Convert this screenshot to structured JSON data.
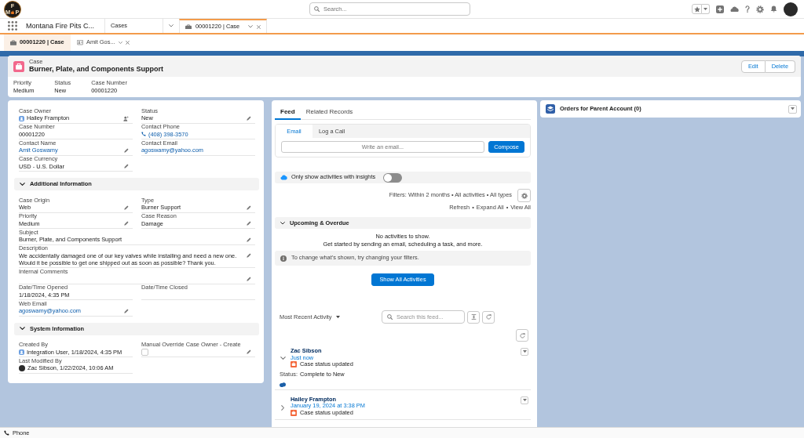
{
  "header": {
    "logo": {
      "letters": [
        "F",
        "M",
        "P"
      ]
    },
    "search": {
      "placeholder": "Search..."
    }
  },
  "nav": {
    "app_name": "Montana Fire Pits C...",
    "tabs": [
      {
        "kind": "object",
        "label": "Cases",
        "selected": false
      },
      {
        "kind": "record",
        "label": "00001220 | Case",
        "selected": true
      }
    ]
  },
  "subtabs": [
    {
      "kind": "case",
      "label": "00001220 | Case",
      "selected": true
    },
    {
      "kind": "contact",
      "label": "Amit Gos...",
      "selected": false
    }
  ],
  "record": {
    "object": "Case",
    "title": "Burner, Plate, and Components Support",
    "actions": [
      "Edit",
      "Delete"
    ],
    "highlights": [
      {
        "label": "Priority",
        "value": "Medium"
      },
      {
        "label": "Status",
        "value": "New"
      },
      {
        "label": "Case Number",
        "value": "00001220"
      }
    ]
  },
  "details": {
    "sections": [
      {
        "rows": [
          {
            "kind": "pair",
            "fields": [
              {
                "label": "Case Owner",
                "kind": "user",
                "value": "Hailey Frampton",
                "editable": true
              },
              {
                "label": "Status",
                "kind": "text",
                "value": "New",
                "editable": true
              }
            ]
          },
          {
            "kind": "pair",
            "fields": [
              {
                "label": "Case Number",
                "kind": "text",
                "value": "00001220",
                "editable": false
              },
              {
                "label": "Contact Phone",
                "kind": "phone",
                "value": "(408) 398-3570",
                "editable": false
              }
            ]
          },
          {
            "kind": "pair",
            "fields": [
              {
                "label": "Contact Name",
                "kind": "link",
                "value": "Amit Goswamy",
                "editable": true
              },
              {
                "label": "Contact Email",
                "kind": "link",
                "value": "agoswamy@yahoo.com",
                "editable": false
              }
            ]
          },
          {
            "kind": "pair",
            "fields": [
              {
                "label": "Case Currency",
                "kind": "text",
                "value": "USD - U.S. Dollar",
                "editable": true
              }
            ]
          }
        ]
      },
      {
        "title": "Additional Information",
        "expanded": true,
        "rows": [
          {
            "kind": "pair",
            "fields": [
              {
                "label": "Case Origin",
                "kind": "text",
                "value": "Web",
                "editable": true
              },
              {
                "label": "Type",
                "kind": "text",
                "value": "Burner Support",
                "editable": true
              }
            ]
          },
          {
            "kind": "pair",
            "fields": [
              {
                "label": "Priority",
                "kind": "text",
                "value": "Medium",
                "editable": true
              },
              {
                "label": "Case Reason",
                "kind": "text",
                "value": "Damage",
                "editable": true
              }
            ]
          },
          {
            "kind": "wide",
            "fields": [
              {
                "label": "Subject",
                "kind": "text",
                "value": "Burner, Plate, and Components Support",
                "editable": true
              }
            ]
          },
          {
            "kind": "wide",
            "fields": [
              {
                "label": "Description",
                "kind": "text",
                "value": "We accidentally damaged one of our key valves while installing and need a new one. Would it be possible to get one shipped out as soon as possible? Thank you.",
                "editable": true
              }
            ]
          },
          {
            "kind": "wide",
            "fields": [
              {
                "label": "Internal Comments",
                "kind": "text",
                "editable": true
              }
            ]
          },
          {
            "kind": "pair",
            "fields": [
              {
                "label": "Date/Time Opened",
                "kind": "text",
                "value": "1/18/2024, 4:35 PM",
                "editable": false
              },
              {
                "label": "Date/Time Closed",
                "kind": "text",
                "editable": false
              }
            ]
          },
          {
            "kind": "pair",
            "fields": [
              {
                "label": "Web Email",
                "kind": "link",
                "value": "agoswamy@yahoo.com",
                "editable": true
              }
            ]
          }
        ]
      },
      {
        "title": "System Information",
        "expanded": true,
        "rows": [
          {
            "kind": "pair",
            "fields": [
              {
                "label": "Created By",
                "kind": "user",
                "value": "Integration User",
                "suffix": ", 1/18/2024, 4:35 PM",
                "editable": false
              },
              {
                "label": "Manual Override Case Owner - Create",
                "kind": "checkbox",
                "checked": false,
                "editable": true
              }
            ]
          },
          {
            "kind": "pair",
            "fields": [
              {
                "label": "Last Modified By",
                "kind": "photo-user",
                "value": "Zac Sibson",
                "suffix": ", 1/22/2024, 10:06 AM",
                "editable": false
              }
            ]
          }
        ]
      }
    ]
  },
  "activity": {
    "tabs": [
      {
        "label": "Feed",
        "selected": true
      },
      {
        "label": "Related Records",
        "selected": false
      }
    ],
    "publisher": {
      "tabs": [
        {
          "label": "Email",
          "selected": true
        },
        {
          "label": "Log a Call",
          "selected": false
        }
      ],
      "placeholder": "Write an email...",
      "button": "Compose"
    },
    "insights": {
      "label": "Only show activities with insights",
      "on": false
    },
    "filters": "Filters: Within 2 months • All activities • All types",
    "links": [
      "Refresh",
      "Expand All",
      "View All"
    ],
    "link_separator": "•",
    "upcoming": {
      "title": "Upcoming & Overdue",
      "expanded": true,
      "empty_title": "No activities to show.",
      "empty_hint": "Get started by sending an email, scheduling a task, and more.",
      "info": "To change what's shown, try changing your filters."
    },
    "show_all": "Show All Activities",
    "sort": "Most Recent Activity",
    "search": {
      "placeholder": "Search this feed..."
    },
    "items": [
      {
        "author": "Zac Sibson",
        "time": "Just now",
        "subject": "Case status updated",
        "expanded": true,
        "detail": {
          "label": "Status:",
          "value": "Complete to New"
        }
      },
      {
        "author": "Hailey Frampton",
        "time": "January 19, 2024 at 3:38 PM",
        "subject": "Case status updated",
        "expanded": false
      }
    ]
  },
  "related": {
    "title": "Orders for Parent Account (0)"
  },
  "utility_bar": {
    "items": [
      {
        "label": "Phone"
      }
    ]
  }
}
